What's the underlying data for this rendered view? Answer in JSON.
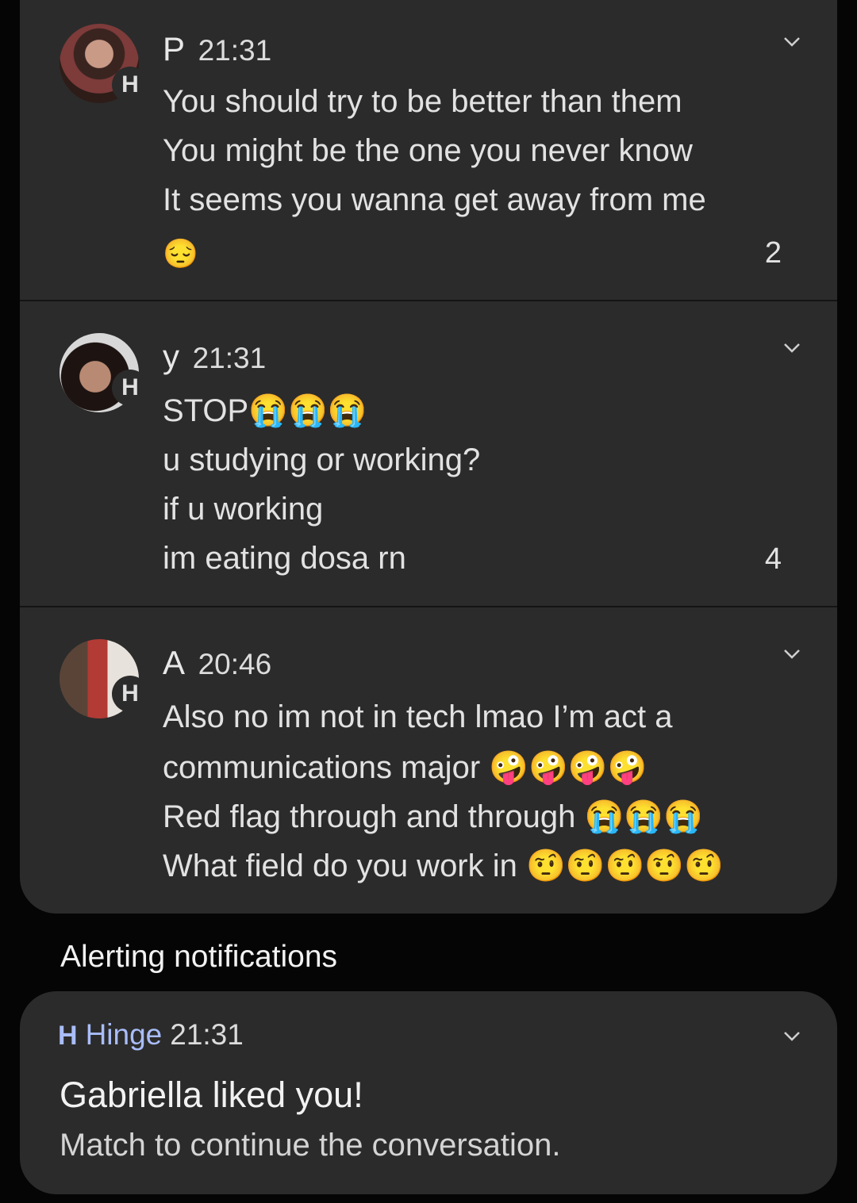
{
  "conversations": [
    {
      "name": "P",
      "time": "21:31",
      "badge_icon": "H",
      "lines": [
        "You should try to be better than them",
        "You might be the one you never know",
        "It seems you wanna get away from me",
        "😔"
      ],
      "count": "2"
    },
    {
      "name": "y",
      "time": "21:31",
      "badge_icon": "H",
      "lines": [
        "STOP😭😭😭",
        "u studying or working?",
        "if u working",
        "im eating dosa rn"
      ],
      "count": "4"
    },
    {
      "name": "A",
      "time": "20:46",
      "badge_icon": "H",
      "lines": [
        "Also no im not in tech lmao I’m act a",
        "communications major 🤪🤪🤪🤪",
        "Red flag through and through 😭😭😭",
        "What field do you work in 🤨🤨🤨🤨🤨"
      ]
    }
  ],
  "section_label": "Alerting notifications",
  "alert": {
    "app_icon": "H",
    "app_name": "Hinge",
    "time": "21:31",
    "title": "Gabriella liked you!",
    "body": "Match to continue the conversation."
  },
  "colors": {
    "card_bg": "#2b2b2b",
    "page_bg": "#050505",
    "accent": "#a9bdfa"
  }
}
